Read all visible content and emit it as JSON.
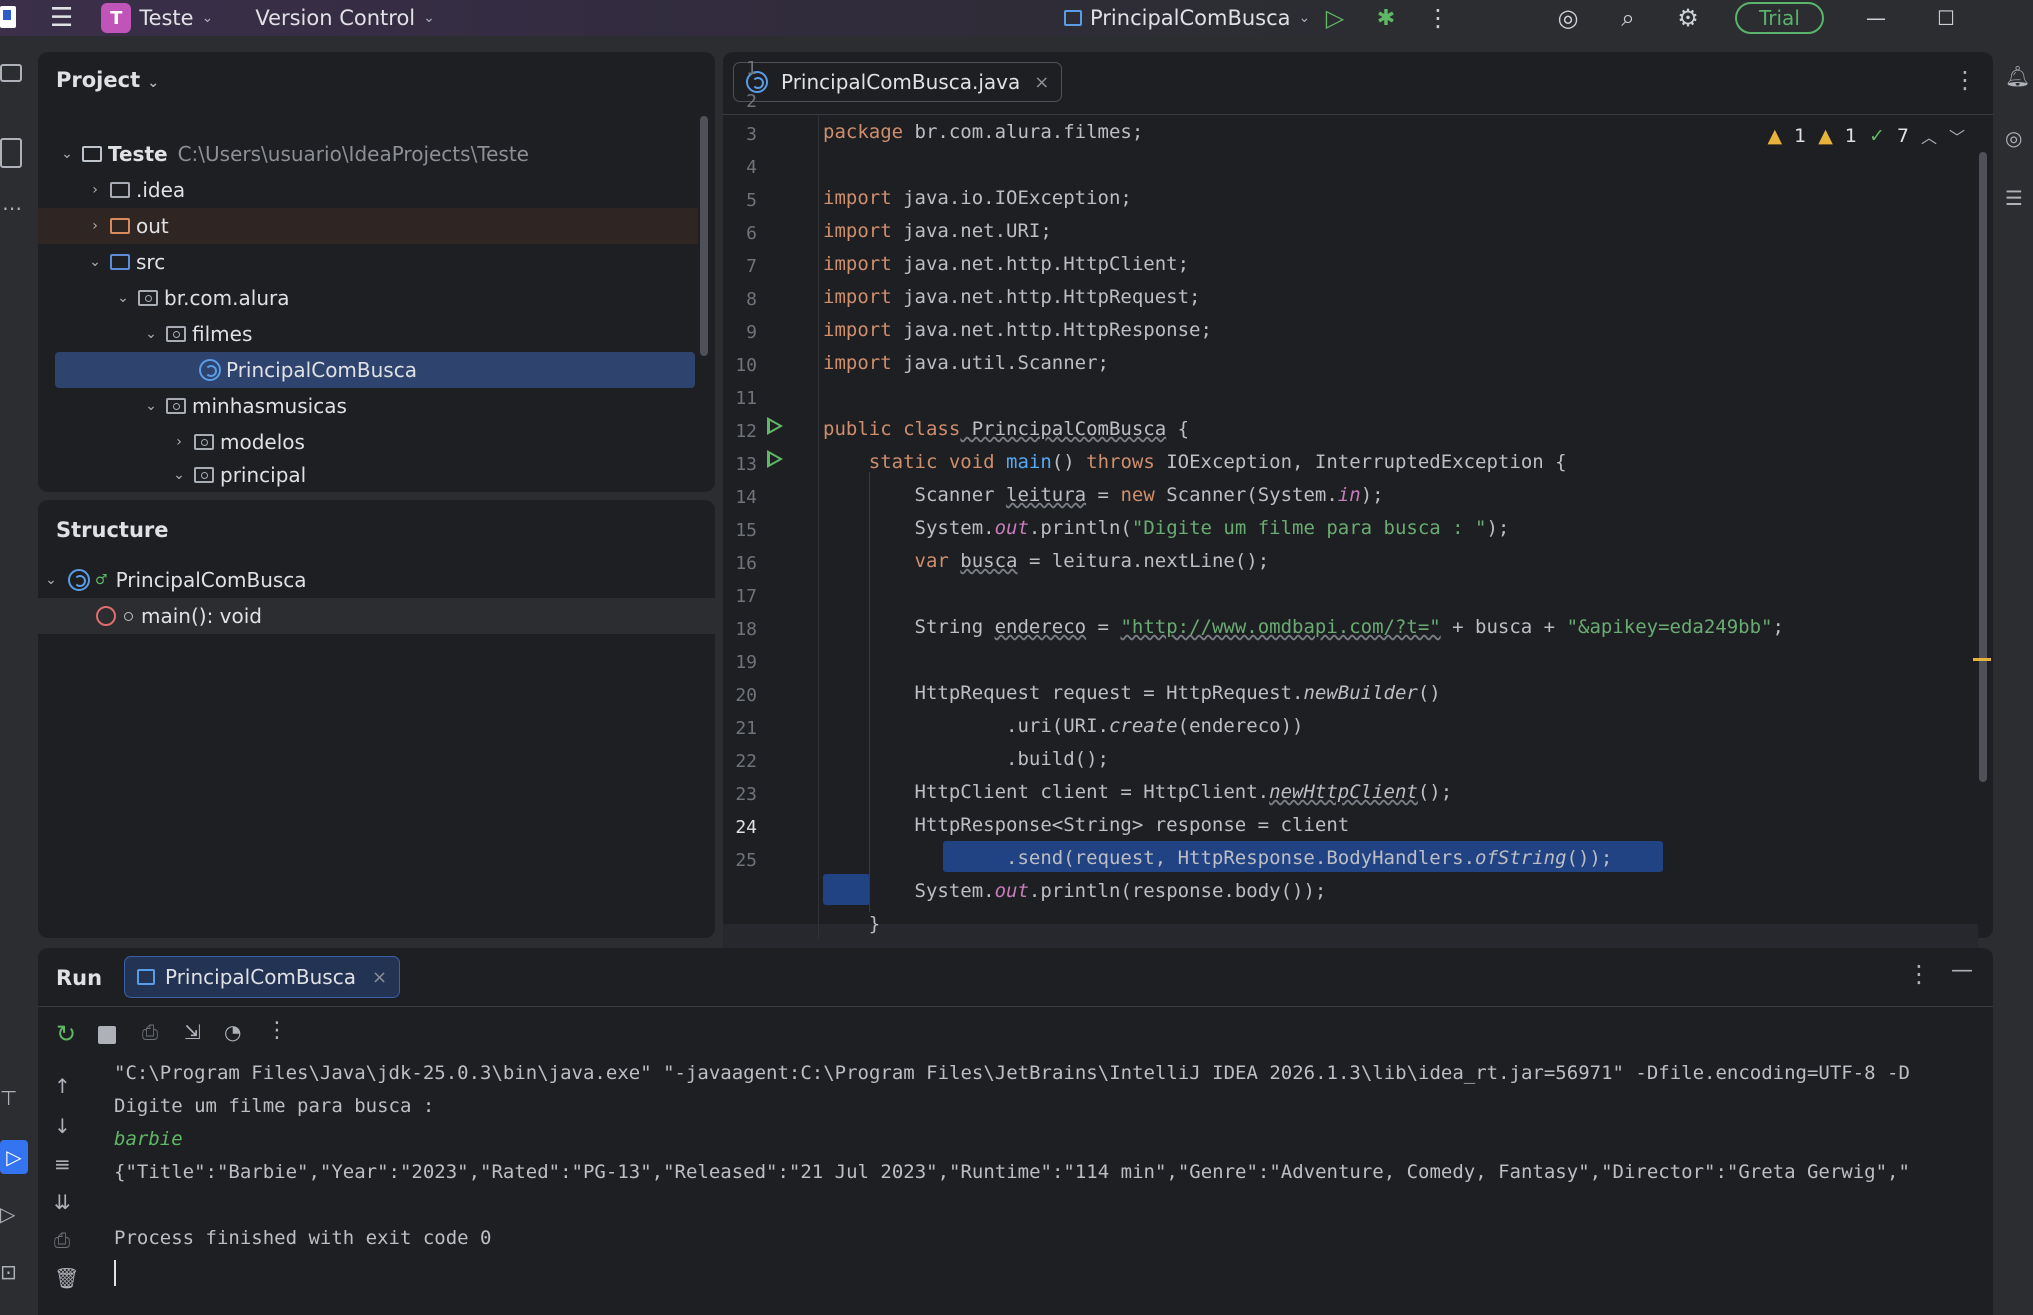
{
  "titlebar": {
    "project_badge": "T",
    "project_name": "Teste",
    "vcs": "Version Control",
    "run_config": "PrincipalComBusca",
    "trial": "Trial"
  },
  "project_panel": {
    "title": "Project",
    "tree": [
      {
        "label": "Teste",
        "path": "C:\\Users\\usuario\\IdeaProjects\\Teste"
      },
      {
        "label": ".idea"
      },
      {
        "label": "out"
      },
      {
        "label": "src"
      },
      {
        "label": "br.com.alura"
      },
      {
        "label": "filmes"
      },
      {
        "label": "PrincipalComBusca"
      },
      {
        "label": "minhasmusicas"
      },
      {
        "label": "modelos"
      },
      {
        "label": "principal"
      }
    ]
  },
  "structure_panel": {
    "title": "Structure",
    "root": "PrincipalComBusca",
    "member": "main(): void"
  },
  "editor": {
    "tab": "PrincipalComBusca.java",
    "inspections": {
      "warnings": "1",
      "weak_warnings": "1",
      "ok": "7"
    },
    "line_numbers": [
      "1",
      "2",
      "3",
      "4",
      "5",
      "6",
      "7",
      "8",
      "9",
      "10",
      "11",
      "12",
      "13",
      "14",
      "15",
      "16",
      "17",
      "18",
      "19",
      "20",
      "21",
      "22",
      "23",
      "24",
      "25"
    ],
    "code": {
      "l1a": "package",
      "l1b": " br.com.alura.filmes;",
      "l3a": "import",
      "l3b": " java.io.IOException;",
      "l4a": "import",
      "l4b": " java.net.URI;",
      "l5a": "import",
      "l5b": " java.net.http.HttpClient;",
      "l6a": "import",
      "l6b": " java.net.http.HttpRequest;",
      "l7a": "import",
      "l7b": " java.net.http.HttpResponse;",
      "l8a": "import",
      "l8b": " java.util.Scanner;",
      "l10a": "public class",
      "l10b": " PrincipalComBusca",
      "l10c": " {",
      "l11a": "    static void",
      "l11b": " main",
      "l11c": "() ",
      "l11d": "throws",
      "l11e": " IOException, InterruptedException {",
      "l12a": "        Scanner ",
      "l12b": "leitura",
      "l12c": " = ",
      "l12d": "new",
      "l12e": " Scanner(System.",
      "l12f": "in",
      "l12g": ");",
      "l13a": "        System.",
      "l13b": "out",
      "l13c": ".println(",
      "l13d": "\"Digite um filme para busca : \"",
      "l13e": ");",
      "l14a": "        ",
      "l14b": "var",
      "l14c": " ",
      "l14d": "busca",
      "l14e": " = leitura.nextLine();",
      "l16a": "        String ",
      "l16b": "endereco",
      "l16c": " = ",
      "l16d": "\"http://www.omdbapi.com/?t=\"",
      "l16e": " + busca + ",
      "l16f": "\"&apikey=eda249bb\"",
      "l16g": ";",
      "l18a": "        HttpRequest request = HttpRequest.",
      "l18b": "newBuilder",
      "l18c": "()",
      "l19a": "                .uri(URI.",
      "l19b": "create",
      "l19c": "(endereco))",
      "l20": "                .build();",
      "l21a": "        HttpClient client = HttpClient.",
      "l21b": "newHttpClient",
      "l21c": "();",
      "l22": "        HttpResponse<String> response = client",
      "l23a": "                .send(request, HttpResponse.BodyHandlers.",
      "l23b": "ofString",
      "l23c": "());",
      "l24a": "        System.",
      "l24b": "out",
      "l24c": ".println(response.body());",
      "l25": "    }"
    }
  },
  "run_panel": {
    "title": "Run",
    "tab": "PrincipalComBusca",
    "console": [
      "\"C:\\Program Files\\Java\\jdk-25.0.3\\bin\\java.exe\" \"-javaagent:C:\\Program Files\\JetBrains\\IntelliJ IDEA 2026.1.3\\lib\\idea_rt.jar=56971\" -Dfile.encoding=UTF-8 -D",
      "Digite um filme para busca :",
      "barbie",
      "{\"Title\":\"Barbie\",\"Year\":\"2023\",\"Rated\":\"PG-13\",\"Released\":\"21 Jul 2023\",\"Runtime\":\"114 min\",\"Genre\":\"Adventure, Comedy, Fantasy\",\"Director\":\"Greta Gerwig\",\"",
      "Process finished with exit code 0"
    ]
  },
  "colors": {
    "accent": "#3574f0",
    "keyword": "#cf8e6d",
    "string": "#6aab73",
    "function": "#56a8f5",
    "trial": "#5bb46e"
  }
}
